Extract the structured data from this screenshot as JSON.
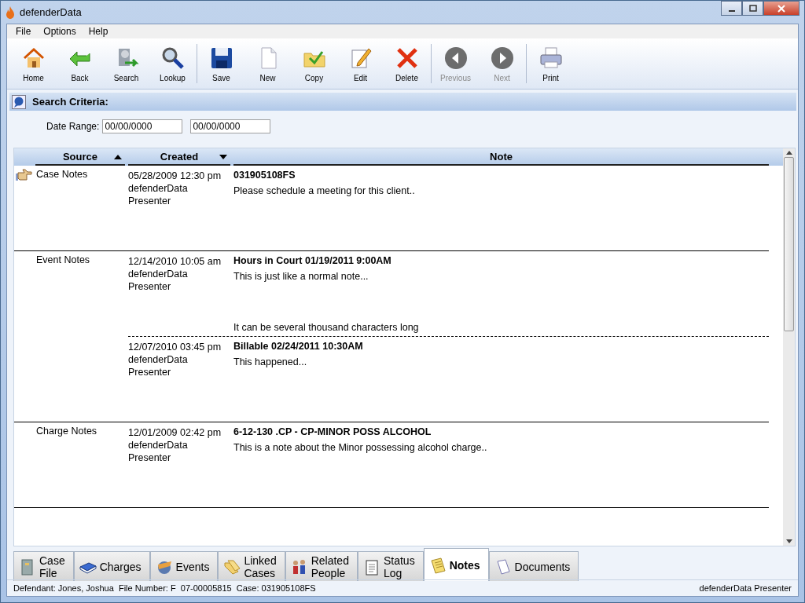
{
  "window": {
    "title": "defenderData"
  },
  "menu": [
    {
      "label": "File"
    },
    {
      "label": "Options"
    },
    {
      "label": "Help"
    }
  ],
  "toolbar": [
    {
      "buttons": [
        {
          "label": "Home",
          "kind": "home",
          "disabled": false
        },
        {
          "label": "Back",
          "kind": "back",
          "disabled": false
        },
        {
          "label": "Search",
          "kind": "search",
          "disabled": false
        },
        {
          "label": "Lookup",
          "kind": "lookup",
          "disabled": false
        }
      ]
    },
    {
      "buttons": [
        {
          "label": "Save",
          "kind": "save",
          "disabled": false
        },
        {
          "label": "New",
          "kind": "new",
          "disabled": false
        },
        {
          "label": "Copy",
          "kind": "copy",
          "disabled": false
        },
        {
          "label": "Edit",
          "kind": "edit",
          "disabled": false
        },
        {
          "label": "Delete",
          "kind": "delete",
          "disabled": false
        }
      ]
    },
    {
      "buttons": [
        {
          "label": "Previous",
          "kind": "previous",
          "disabled": true
        },
        {
          "label": "Next",
          "kind": "next",
          "disabled": true
        }
      ]
    },
    {
      "buttons": [
        {
          "label": "Print",
          "kind": "print",
          "disabled": false
        }
      ]
    }
  ],
  "search_criteria": {
    "title": "Search Criteria:",
    "date_range_label": "Date Range:",
    "date_from": "00/00/0000",
    "date_to": "00/00/0000"
  },
  "table": {
    "columns": [
      {
        "label": "Source",
        "sort_ascending": true,
        "sort_descending": false
      },
      {
        "label": "Created",
        "sort_ascending": false,
        "sort_descending": true
      },
      {
        "label": "Note",
        "sort_ascending": false,
        "sort_descending": false
      }
    ],
    "groups": [
      {
        "source": "Case Notes",
        "selected": true,
        "notes": [
          {
            "created": "05/28/2009 12:30 pm",
            "author": "defenderData Presenter",
            "title": "031905108FS",
            "body": [
              "Please schedule a meeting for this client.."
            ]
          }
        ]
      },
      {
        "source": "Event Notes",
        "selected": false,
        "notes": [
          {
            "created": "12/14/2010 10:05 am",
            "author": "defenderData Presenter",
            "title": "Hours in Court 01/19/2011 9:00AM",
            "body": [
              "This is just like a normal note...",
              "It can be several thousand characters long"
            ]
          },
          {
            "created": "12/07/2010 03:45 pm",
            "author": "defenderData Presenter",
            "title": "Billable 02/24/2011 10:30AM",
            "body": [
              "This happened..."
            ]
          }
        ]
      },
      {
        "source": "Charge Notes",
        "selected": false,
        "notes": [
          {
            "created": "12/01/2009 02:42 pm",
            "author": "defenderData Presenter",
            "title": "6-12-130 .CP - CP-MINOR POSS ALCOHOL",
            "body": [
              "This is a note about the Minor possessing alcohol charge.."
            ]
          }
        ]
      }
    ]
  },
  "tabs": [
    {
      "label": "Case File",
      "kind": "cabinet",
      "selected": false
    },
    {
      "label": "Charges",
      "kind": "book",
      "selected": false
    },
    {
      "label": "Events",
      "kind": "globe",
      "selected": false
    },
    {
      "label": "Linked Cases",
      "kind": "folders",
      "selected": false
    },
    {
      "label": "Related People",
      "kind": "people",
      "selected": false
    },
    {
      "label": "Status Log",
      "kind": "notepad",
      "selected": false
    },
    {
      "label": "Notes",
      "kind": "note",
      "selected": true
    },
    {
      "label": "Documents",
      "kind": "document",
      "selected": false
    }
  ],
  "status_bar": {
    "left": "Defendant: Jones, Joshua  File Number: F  07-00005815  Case: 031905108FS",
    "right": "defenderData Presenter"
  }
}
